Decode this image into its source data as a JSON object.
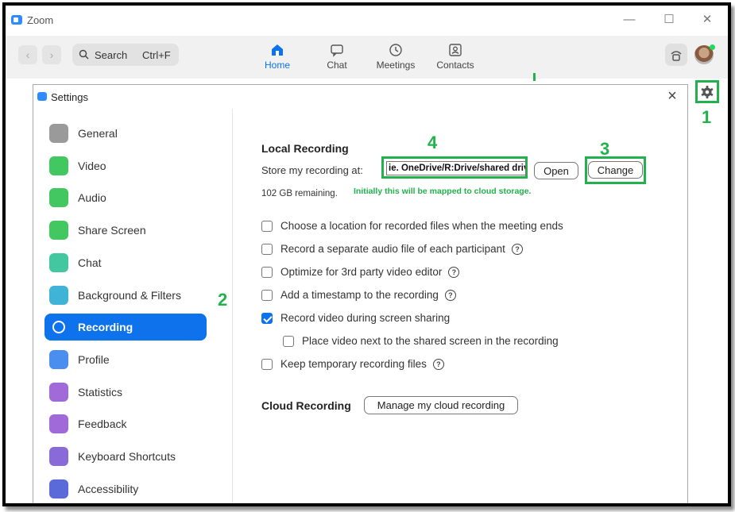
{
  "app": {
    "title": "Zoom",
    "minimize": "—",
    "maximize": "☐",
    "close": "✕"
  },
  "toolbar": {
    "back": "‹",
    "forward": "›",
    "search_label": "Search",
    "search_shortcut": "Ctrl+F",
    "tabs": [
      {
        "label": "Home",
        "active": true
      },
      {
        "label": "Chat"
      },
      {
        "label": "Meetings"
      },
      {
        "label": "Contacts"
      }
    ]
  },
  "annotations": {
    "a1": "1",
    "a2": "2",
    "a3": "3",
    "a4": "4",
    "color": "#22b14c"
  },
  "dialog": {
    "title": "Settings",
    "close": "×",
    "sidebar": [
      {
        "label": "General",
        "color": "#9a9a9a"
      },
      {
        "label": "Video",
        "color": "#43c760"
      },
      {
        "label": "Audio",
        "color": "#43c760"
      },
      {
        "label": "Share Screen",
        "color": "#43c760"
      },
      {
        "label": "Chat",
        "color": "#43c7a0"
      },
      {
        "label": "Background & Filters",
        "color": "#3fb4d6"
      },
      {
        "label": "Recording",
        "color": "#ffffff",
        "active": true
      },
      {
        "label": "Profile",
        "color": "#4a8ff0"
      },
      {
        "label": "Statistics",
        "color": "#a06ad8"
      },
      {
        "label": "Feedback",
        "color": "#a06ad8"
      },
      {
        "label": "Keyboard Shortcuts",
        "color": "#8a6ad8"
      },
      {
        "label": "Accessibility",
        "color": "#5a6ad8"
      }
    ],
    "local": {
      "title": "Local Recording",
      "store_label": "Store my recording at:",
      "path_value": "ie. OneDrive/R:Drive/shared drive",
      "open_label": "Open",
      "change_label": "Change",
      "remaining": "102 GB remaining.",
      "note": "Initially this will be mapped to cloud storage."
    },
    "options": [
      {
        "label": "Choose a location for recorded files when the meeting ends",
        "checked": false,
        "help": false
      },
      {
        "label": "Record a separate audio file of each participant",
        "checked": false,
        "help": true
      },
      {
        "label": "Optimize for 3rd party video editor",
        "checked": false,
        "help": true
      },
      {
        "label": "Add a timestamp to the recording",
        "checked": false,
        "help": true
      },
      {
        "label": "Record video during screen sharing",
        "checked": true,
        "help": false
      },
      {
        "label": "Place video next to the shared screen in the recording",
        "checked": false,
        "help": false,
        "indent": true
      },
      {
        "label": "Keep temporary recording files",
        "checked": false,
        "help": true
      }
    ],
    "cloud": {
      "title": "Cloud Recording",
      "button": "Manage my cloud recording"
    }
  }
}
